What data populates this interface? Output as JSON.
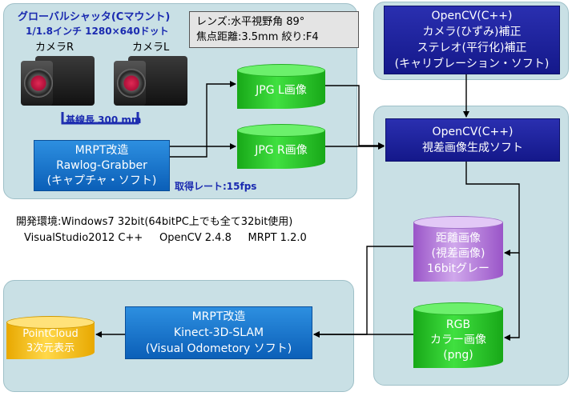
{
  "camera": {
    "title": "グローバルシャッタ(Cマウント)",
    "spec": "1/1.8インチ 1280×640ドット",
    "left_label": "カメラR",
    "right_label": "カメラL",
    "baseline": "基線長 300",
    "baseline_unit": "mm"
  },
  "lens_info": {
    "line1": "レンズ:水平視野角 89°",
    "line2": "焦点距離:3.5mm 絞り:F4"
  },
  "grabber": {
    "line1": "MRPT改造",
    "line2": "Rawlog-Grabber",
    "line3": "(キャプチャ・ソフト)"
  },
  "frame_rate": "取得レート:15fps",
  "jpg_l": "JPG L画像",
  "jpg_r": "JPG R画像",
  "calib": {
    "line1": "OpenCV(C++)",
    "line2": "カメラ(ひずみ)補正",
    "line3": "ステレオ(平行化)補正",
    "line4": "(キャリブレーション・ソフト)"
  },
  "disparity": {
    "line1": "OpenCV(C++)",
    "line2": "視差画像生成ソフト"
  },
  "depth": {
    "line1": "距離画像",
    "line2": "(視差画像)",
    "line3": "16bitグレー"
  },
  "rgb": {
    "line1": "RGB",
    "line2": "カラー画像",
    "line3": "(png)"
  },
  "env": {
    "line1": "開発環境:Windows7 32bit(64bitPC上でも全て32bit使用)",
    "line2": "VisualStudio2012 C++     OpenCV 2.4.8     MRPT 1.2.0"
  },
  "slam": {
    "line1": "MRPT改造",
    "line2": "Kinect-3D-SLAM",
    "line3": "(Visual Odometory ソフト)"
  },
  "pointcloud": {
    "line1": "PointCloud",
    "line2": "3次元表示"
  }
}
